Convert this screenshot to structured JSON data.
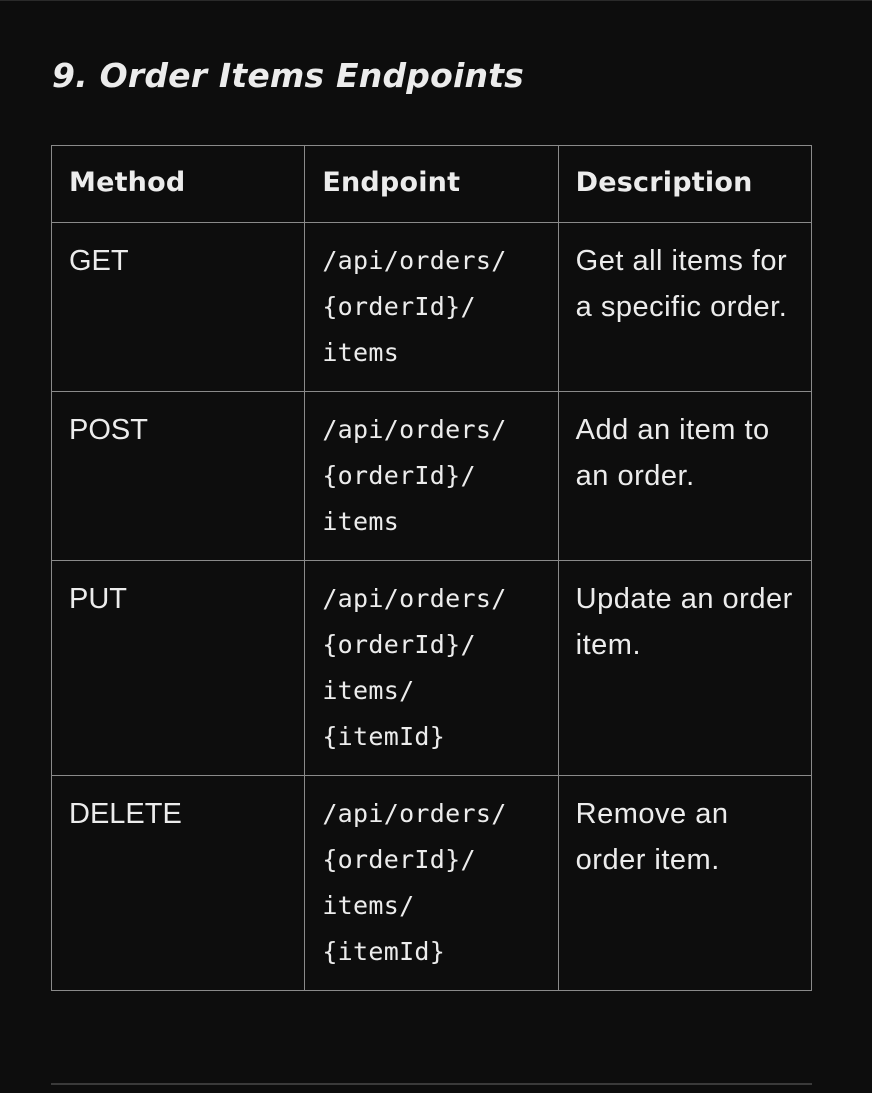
{
  "section": {
    "title": "9. Order Items Endpoints"
  },
  "table": {
    "headers": {
      "method": "Method",
      "endpoint": "Endpoint",
      "description": "Description"
    },
    "rows": [
      {
        "method": "GET",
        "endpoint_lines": [
          "/api/orders/",
          "{orderId}/",
          "items"
        ],
        "description": "Get all items for a specific order."
      },
      {
        "method": "POST",
        "endpoint_lines": [
          "/api/orders/",
          "{orderId}/",
          "items"
        ],
        "description": "Add an item to an order."
      },
      {
        "method": "PUT",
        "endpoint_lines": [
          "/api/orders/",
          "{orderId}/",
          "items/",
          "{itemId}"
        ],
        "description": "Update an order item."
      },
      {
        "method": "DELETE",
        "endpoint_lines": [
          "/api/orders/",
          "{orderId}/",
          "items/",
          "{itemId}"
        ],
        "description": "Remove an order item."
      }
    ]
  },
  "colors": {
    "background": "#0d0d0d",
    "text": "#ececec",
    "border": "#8a8a8a"
  }
}
